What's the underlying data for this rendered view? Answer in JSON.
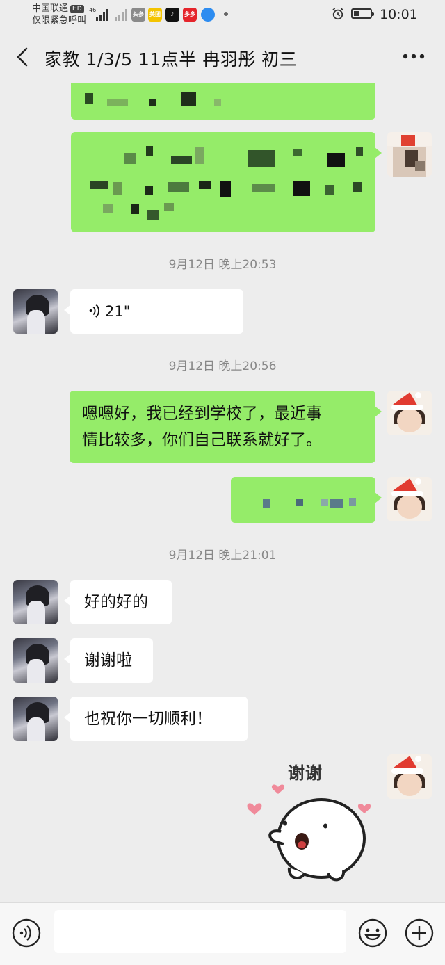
{
  "status_bar": {
    "carrier": "中国联通",
    "hd_badge": "HD",
    "carrier_note": "仅限紧急呼叫",
    "network": "46",
    "app_icons": [
      {
        "name": "toutiao-icon",
        "label": "头条",
        "color": "#8a8a8a"
      },
      {
        "name": "meituan-icon",
        "label": "美团",
        "color": "#f4c400"
      },
      {
        "name": "douyin-icon",
        "label": "♪",
        "color": "#111111"
      },
      {
        "name": "pinduoduo-icon",
        "label": "多多",
        "color": "#e5242b"
      },
      {
        "name": "browser-icon",
        "label": "",
        "color": "#2d8cf0"
      }
    ],
    "battery_level": 0.3,
    "time": "10:01"
  },
  "header": {
    "title": "家教  1/3/5  11点半  冉羽彤 初三"
  },
  "messages": [
    {
      "type": "timestamp",
      "text": "9月12日 晚上20:53"
    },
    {
      "type": "voice",
      "side": "left",
      "duration": "21\""
    },
    {
      "type": "timestamp",
      "text": "9月12日 晚上20:56"
    },
    {
      "type": "text",
      "side": "right",
      "lines": [
        "嗯嗯好，我已经到学校了，最近事",
        "情比较多，你们自己联系就好了。"
      ]
    },
    {
      "type": "timestamp",
      "text": "9月12日 晚上21:01"
    },
    {
      "type": "text",
      "side": "left",
      "text": "好的好的"
    },
    {
      "type": "text",
      "side": "left",
      "text": "谢谢啦"
    },
    {
      "type": "text",
      "side": "left",
      "text": "也祝你一切顺利！"
    },
    {
      "type": "sticker",
      "side": "right",
      "text": "谢谢"
    }
  ],
  "colors": {
    "background": "#ededed",
    "bubble_mine": "#95ec69",
    "bubble_theirs": "#ffffff"
  }
}
